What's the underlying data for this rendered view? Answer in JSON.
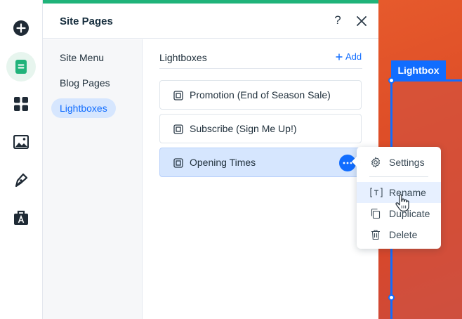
{
  "rail": {
    "items": [
      {
        "name": "add-icon",
        "active": false
      },
      {
        "name": "pages-icon",
        "active": true
      },
      {
        "name": "apps-icon",
        "active": false
      },
      {
        "name": "media-icon",
        "active": false
      },
      {
        "name": "pen-icon",
        "active": false
      },
      {
        "name": "business-tools-icon",
        "active": false
      }
    ]
  },
  "panel": {
    "title": "Site Pages",
    "help_label": "?",
    "nav": [
      {
        "label": "Site Menu",
        "active": false
      },
      {
        "label": "Blog Pages",
        "active": false
      },
      {
        "label": "Lightboxes",
        "active": true
      }
    ],
    "content": {
      "section_title": "Lightboxes",
      "add_label": "Add",
      "pages": [
        {
          "label": "Promotion (End of Season Sale)",
          "selected": false
        },
        {
          "label": "Subscribe (Sign Me Up!)",
          "selected": false
        },
        {
          "label": "Opening Times",
          "selected": true
        }
      ]
    }
  },
  "context_menu": {
    "items": [
      {
        "label": "Settings",
        "icon": "gear-icon",
        "hover": false
      },
      {
        "label": "Rename",
        "icon": "rename-icon",
        "hover": true
      },
      {
        "label": "Duplicate",
        "icon": "duplicate-icon",
        "hover": false
      },
      {
        "label": "Delete",
        "icon": "trash-icon",
        "hover": false
      }
    ]
  },
  "canvas": {
    "tag_label": "Lightbox"
  },
  "colors": {
    "accent_blue": "#116dff",
    "brand_green": "#20b37a",
    "selected_bg": "#d6e6fe",
    "canvas_orange": "#e0512a"
  }
}
